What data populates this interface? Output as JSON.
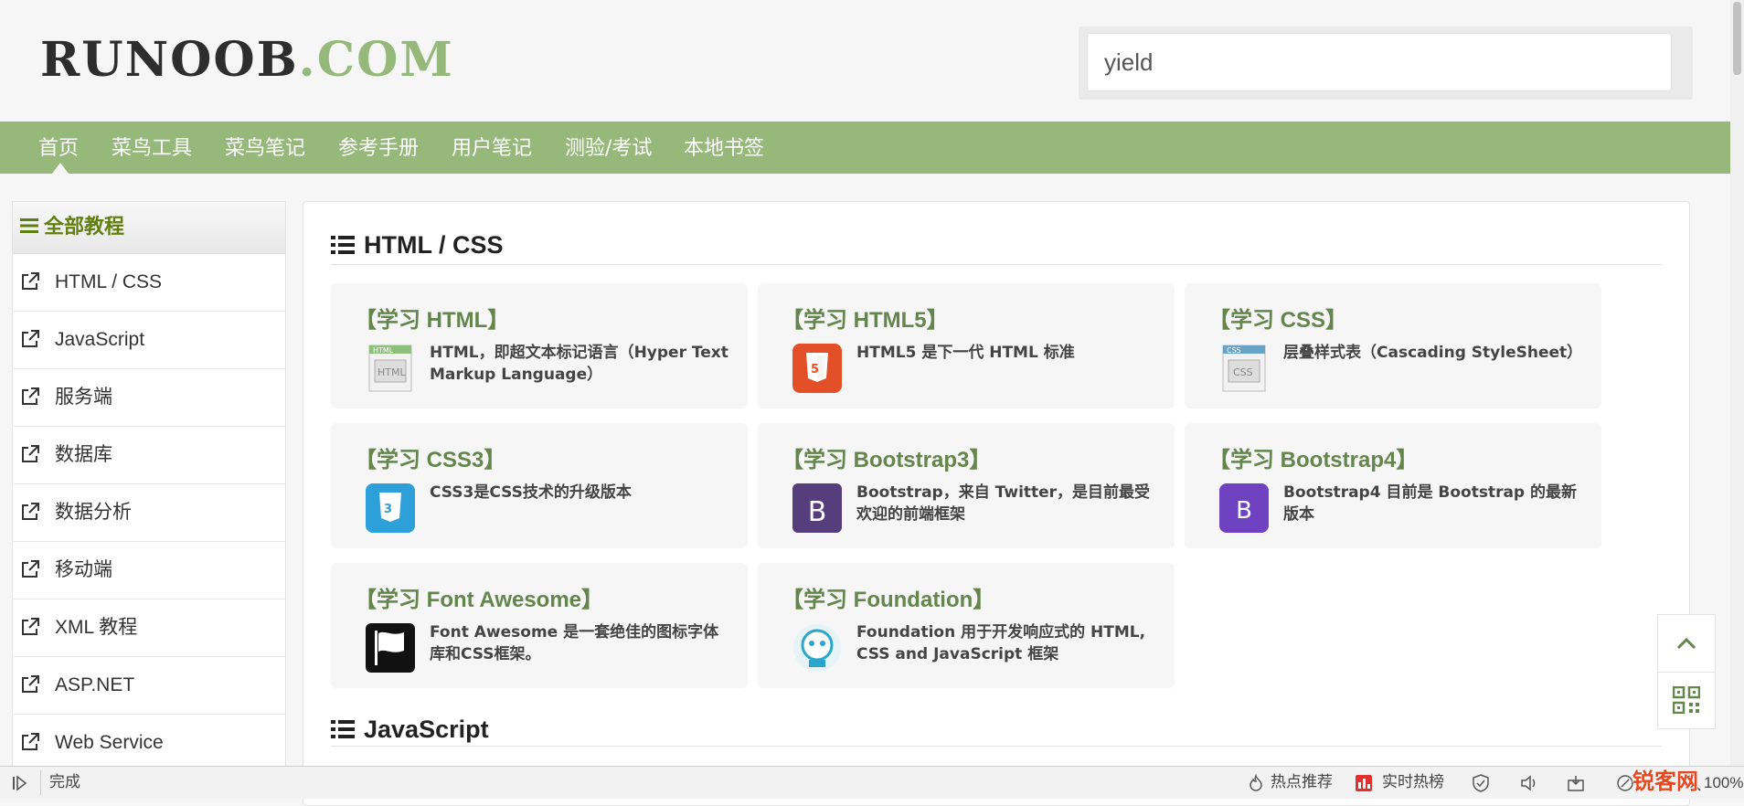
{
  "header": {
    "logo_text": "RUNOOB",
    "logo_dot": ".COM",
    "search_value": "yield"
  },
  "nav": {
    "items": [
      "首页",
      "菜鸟工具",
      "菜鸟笔记",
      "参考手册",
      "用户笔记",
      "测验/考试",
      "本地书签"
    ]
  },
  "sidebar": {
    "title": "全部教程",
    "items": [
      "HTML / CSS",
      "JavaScript",
      "服务端",
      "数据库",
      "数据分析",
      "移动端",
      "XML 教程",
      "ASP.NET",
      "Web Service"
    ]
  },
  "main": {
    "sections": [
      {
        "title": "HTML / CSS",
        "cards": [
          {
            "title": "【学习 HTML】",
            "desc": "HTML，即超文本标记语言（Hyper Text Markup Language）",
            "icon": "html-icon",
            "color": "#cfe0c0"
          },
          {
            "title": "【学习 HTML5】",
            "desc": "HTML5 是下一代 HTML 标准",
            "icon": "html5-icon",
            "color": "#e34f26"
          },
          {
            "title": "【学习 CSS】",
            "desc": "层叠样式表（Cascading StyleSheet）",
            "icon": "css-icon",
            "color": "#cfdde8"
          },
          {
            "title": "【学习 CSS3】",
            "desc": "CSS3是CSS技术的升级版本",
            "icon": "css3-icon",
            "color": "#2d9fd9"
          },
          {
            "title": "【学习 Bootstrap3】",
            "desc": "Bootstrap，来自 Twitter，是目前最受欢迎的前端框架",
            "icon": "bootstrap3-icon",
            "color": "#563d7c"
          },
          {
            "title": "【学习 Bootstrap4】",
            "desc": "Bootstrap4 目前是 Bootstrap 的最新版本",
            "icon": "bootstrap4-icon",
            "color": "#6f42c1"
          },
          {
            "title": "【学习 Font Awesome】",
            "desc": "Font Awesome 是一套绝佳的图标字体库和CSS框架。",
            "icon": "font-awesome-icon",
            "color": "#111111"
          },
          {
            "title": "【学习 Foundation】",
            "desc": "Foundation 用于开发响应式的 HTML, CSS and JavaScript 框架",
            "icon": "foundation-icon",
            "color": "#2ba6cb"
          }
        ]
      },
      {
        "title": "JavaScript",
        "cards": []
      }
    ]
  },
  "statusbar": {
    "status": "完成",
    "hot_recommend": "热点推荐",
    "realtime_hot": "实时热榜",
    "zoom": "100%",
    "watermark": "锐客网"
  },
  "colors": {
    "brand_green": "#96b97b",
    "card_title_green": "#64854c",
    "sidebar_title_green": "#617f10"
  }
}
